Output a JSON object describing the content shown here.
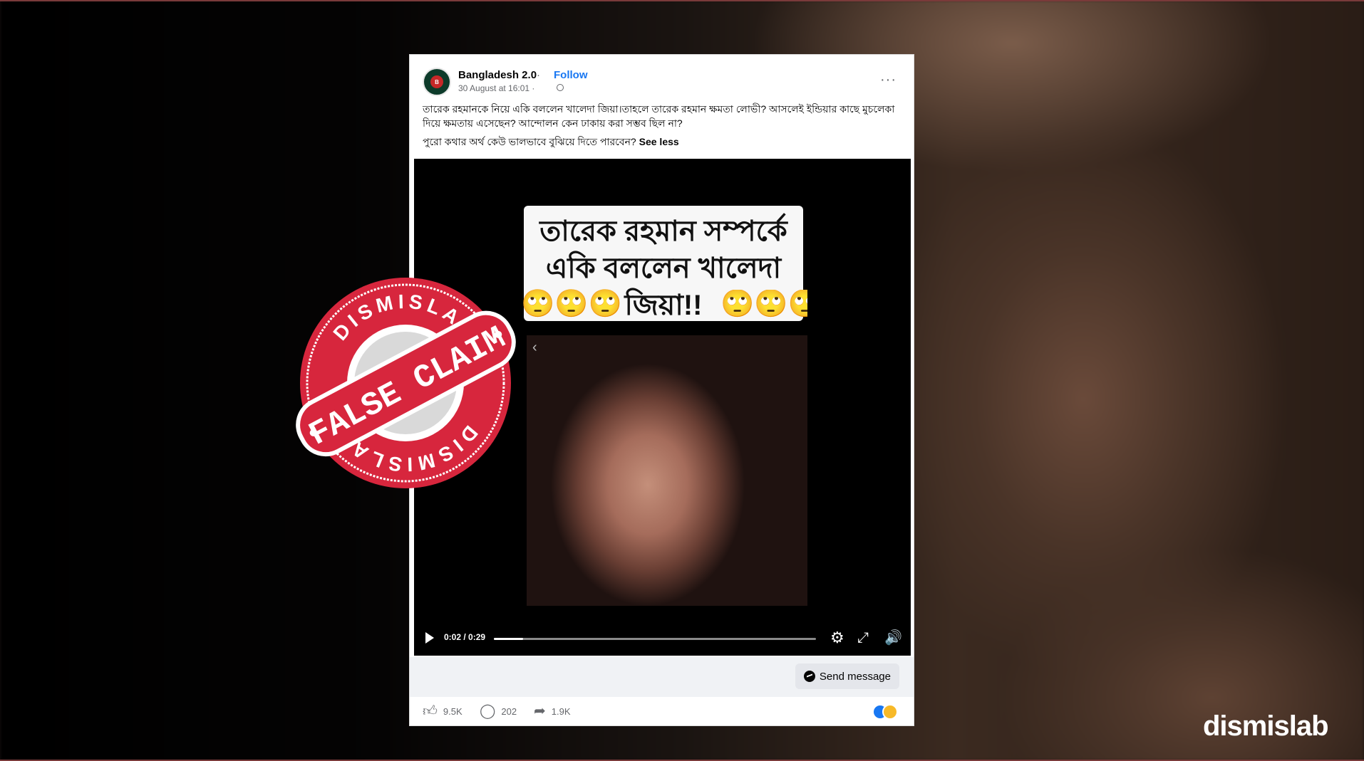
{
  "post": {
    "page_name": "Bangladesh 2.0",
    "separator": "·",
    "follow_label": "Follow",
    "timestamp": "30 August at 16:01 ·",
    "more_label": "···",
    "caption_line1": "তারেক রহমানকে নিয়ে একি বললেন খালেদা জিয়া।তাহলে তারেক রহমান ক্ষমতা লোভী? আসলেই ইন্ডিয়ার কাছে মুচলেকা দিয়ে ক্ষমতায় এসেছেন? আন্দোলন কেন ঢাকায় করা সম্ভব ছিল না?",
    "caption_line2": "পুরো কথার অর্থ কেউ ভালভাবে বুঝিয়ে দিতে পারবেন?",
    "see_less": "See less"
  },
  "video": {
    "title_line1": "তারেক রহমান সম্পর্কে",
    "title_line2": "একি বললেন খালেদা",
    "title_line3": "জিয়া!!",
    "emoji_left": "🙄🙄🙄",
    "emoji_right": "🙄🙄🙄",
    "time": "0:02 / 0:29",
    "progress": 0.09
  },
  "bar": {
    "send_message": "Send message"
  },
  "actions": {
    "likes": "9.5K",
    "comments": "202",
    "shares": "1.9K"
  },
  "stamp": {
    "top_text": "DISMISLAB",
    "bottom_text": "DISMISLAB",
    "label": "FALSE CLAIM",
    "color": "#d7263d"
  },
  "brand": {
    "logo": "dismislab"
  }
}
